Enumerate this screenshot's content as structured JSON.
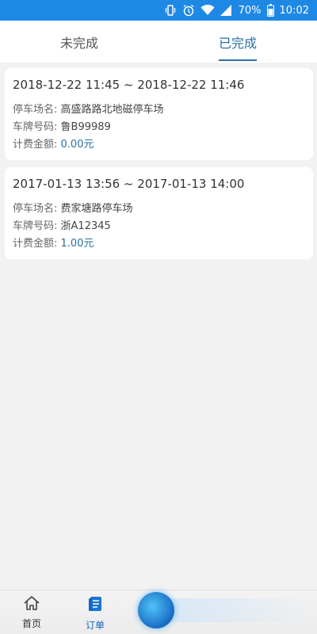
{
  "status_bar": {
    "battery_pct": "70%",
    "time": "10:02",
    "icons": [
      "vibrate-icon",
      "alarm-icon",
      "wifi-icon",
      "signal-icon",
      "battery-icon"
    ]
  },
  "tabs": [
    {
      "label": "未完成",
      "active": false
    },
    {
      "label": "已完成",
      "active": true
    }
  ],
  "orders": [
    {
      "time_range": "2018-12-22 11:45 ~ 2018-12-22 11:46",
      "lot_label": "停车场名:",
      "lot_value": "高盛路路北地磁停车场",
      "plate_label": "车牌号码:",
      "plate_value": "鲁B99989",
      "fee_label": "计费金额:",
      "fee_value": "0.00元"
    },
    {
      "time_range": "2017-01-13 13:56 ~ 2017-01-13 14:00",
      "lot_label": "停车场名:",
      "lot_value": "费家塘路停车场",
      "plate_label": "车牌号码:",
      "plate_value": "浙A12345",
      "fee_label": "计费金额:",
      "fee_value": "1.00元"
    }
  ],
  "bottom_nav": {
    "home_label": "首页",
    "order_label": "订单"
  },
  "colors": {
    "status_bar": "#1e88e5",
    "accent": "#2a6fa0",
    "nav_active": "#1565c0"
  }
}
